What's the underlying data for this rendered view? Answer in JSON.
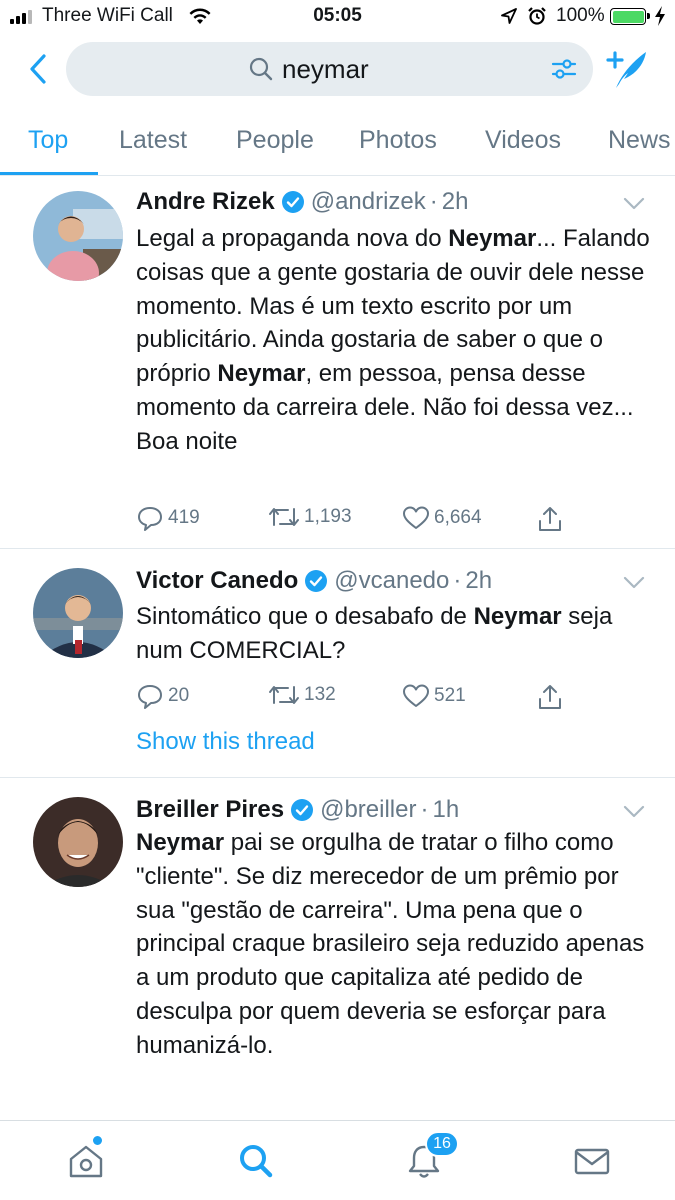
{
  "status_bar": {
    "carrier": "Three WiFi Call",
    "time": "05:05",
    "battery_percent": "100%"
  },
  "search": {
    "query": "neymar"
  },
  "tabs": [
    {
      "label": "Top",
      "active": true
    },
    {
      "label": "Latest",
      "active": false
    },
    {
      "label": "People",
      "active": false
    },
    {
      "label": "Photos",
      "active": false
    },
    {
      "label": "Videos",
      "active": false
    },
    {
      "label": "News",
      "active": false
    }
  ],
  "tweets": [
    {
      "name": "Andre Rizek",
      "handle": "@andrizek",
      "dot": "·",
      "time": "2h",
      "text_parts": [
        {
          "t": "Legal a propaganda nova do "
        },
        {
          "t": "Neymar",
          "b": true
        },
        {
          "t": "... Falando coisas que a gente gostaria de ouvir dele nesse momento. Mas é um texto escrito por um publicitário. Ainda gostaria de saber o que o próprio "
        },
        {
          "t": "Neymar",
          "b": true
        },
        {
          "t": ", em pessoa, pensa desse momento da carreira dele. Não foi dessa vez... Boa noite"
        }
      ],
      "replies": "419",
      "retweets": "1,193",
      "likes": "6,664"
    },
    {
      "name": "Victor Canedo",
      "handle": "@vcanedo",
      "dot": "·",
      "time": "2h",
      "text_parts": [
        {
          "t": "Sintomático que o desabafo de "
        },
        {
          "t": "Neymar",
          "b": true
        },
        {
          "t": " seja num COMERCIAL?"
        }
      ],
      "replies": "20",
      "retweets": "132",
      "likes": "521",
      "thread_link": "Show this thread"
    },
    {
      "name": "Breiller Pires",
      "handle": "@breiller",
      "dot": "·",
      "time": "1h",
      "text_parts": [
        {
          "t": "Neymar",
          "b": true
        },
        {
          "t": " pai se orgulha de tratar o filho como \"cliente\". Se diz merecedor de um prêmio por sua \"gestão de carreira\". Uma pena que o principal craque brasileiro seja reduzido apenas a um produto que capitaliza até pedido de desculpa por quem deveria se esforçar para humanizá-lo."
        }
      ]
    }
  ],
  "bottom_nav": {
    "notifications_badge": "16"
  },
  "colors": {
    "accent": "#1da1f2",
    "muted": "#657786",
    "search_bg": "#e6ecf0"
  }
}
